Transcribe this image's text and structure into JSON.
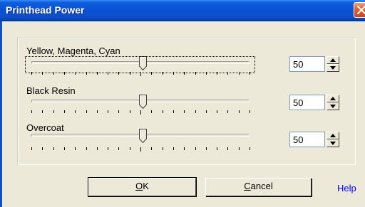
{
  "window": {
    "title": "Printhead Power"
  },
  "rows": [
    {
      "label": "Yellow, Magenta, Cyan",
      "value": "50",
      "level_percent": 50
    },
    {
      "label": "Black Resin",
      "value": "50",
      "level_percent": 50
    },
    {
      "label": "Overcoat",
      "value": "50",
      "level_percent": 50
    }
  ],
  "buttons": {
    "ok": {
      "underlined": "O",
      "rest": "K"
    },
    "cancel": {
      "underlined": "C",
      "rest": "ancel"
    },
    "help": "Help"
  },
  "colors": {
    "titlebar": "#0a52d4",
    "close": "#e5622e",
    "link": "#0000ff",
    "face": "#ece9d8"
  }
}
